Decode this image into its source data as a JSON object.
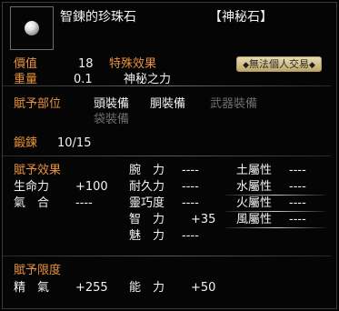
{
  "item": {
    "name": "智鍊的珍珠石",
    "category": "【神秘石】",
    "icon": "pearl-icon"
  },
  "stats": {
    "value_label": "價值",
    "value": "18",
    "effect_label": "特殊效果",
    "weight_label": "重量",
    "weight": "0.1",
    "effect_value": "神秘之力",
    "trade_badge": "無法個人交易",
    "badge_icon": "trade-restricted-icon"
  },
  "assign": {
    "label": "賦予部位",
    "slots_active": [
      "頭裝備",
      "胴裝備"
    ],
    "slots_inactive": [
      "武器裝備",
      "袋裝備"
    ]
  },
  "forge": {
    "label": "鍛鍊",
    "value": "10/15"
  },
  "effects": {
    "label": "賦予效果",
    "left": [
      {
        "name": "生命力",
        "value": "+100"
      },
      {
        "name": "氣　合",
        "value": "----"
      }
    ],
    "mid": [
      {
        "name": "腕　力",
        "value": "----"
      },
      {
        "name": "耐久力",
        "value": "----"
      },
      {
        "name": "靈巧度",
        "value": "----"
      },
      {
        "name": "智　力",
        "value": "+35"
      },
      {
        "name": "魅　力",
        "value": "----"
      }
    ],
    "right": [
      {
        "name": "土屬性",
        "value": "----"
      },
      {
        "name": "水屬性",
        "value": "----"
      },
      {
        "name": "火屬性",
        "value": "----"
      },
      {
        "name": "風屬性",
        "value": "----"
      }
    ]
  },
  "limit": {
    "label": "賦予限度",
    "items": [
      {
        "name": "精　氣",
        "value": "+255"
      },
      {
        "name": "能　力",
        "value": "+50"
      }
    ]
  }
}
